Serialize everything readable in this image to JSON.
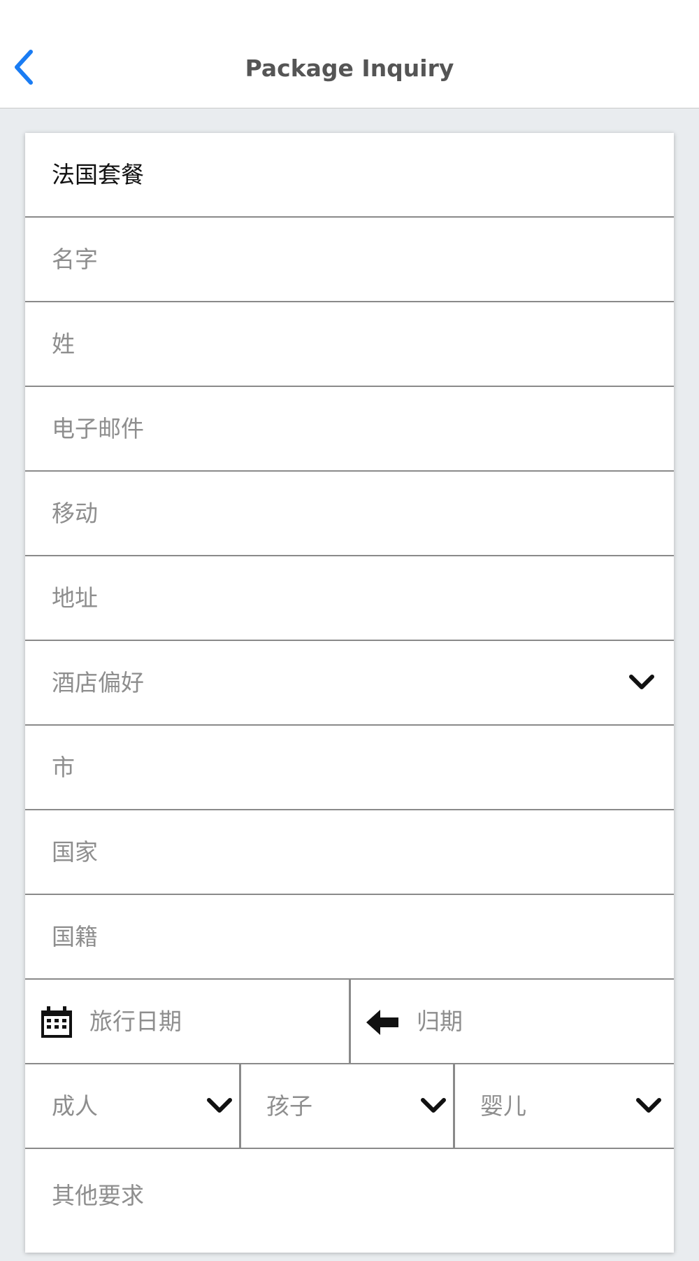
{
  "header": {
    "title": "Package Inquiry"
  },
  "form": {
    "package_name": "法国套餐",
    "fields": {
      "first_name": "名字",
      "last_name": "姓",
      "email": "电子邮件",
      "mobile": "移动",
      "address": "地址",
      "hotel_preference": "酒店偏好",
      "city": "市",
      "country": "国家",
      "nationality": "国籍",
      "travel_date": "旅行日期",
      "return_date": "归期",
      "adults": "成人",
      "children": "孩子",
      "infants": "婴儿",
      "other_requests": "其他要求"
    }
  },
  "colors": {
    "accent": "#1a7cf3",
    "placeholder": "#8e8e8e",
    "divider": "#8a8a8a",
    "background": "#e9ecef"
  },
  "icons": {
    "back": "chevron-left-icon",
    "dropdown": "chevron-down-icon",
    "calendar": "calendar-icon",
    "return": "arrow-left-icon"
  }
}
